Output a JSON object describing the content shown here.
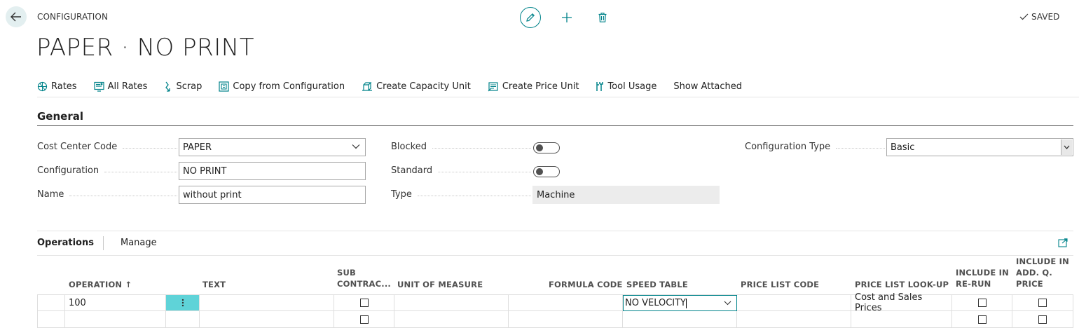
{
  "header": {
    "breadcrumb": "CONFIGURATION",
    "title": "PAPER · NO PRINT",
    "saved_label": "SAVED"
  },
  "actions": [
    {
      "label": "Rates",
      "icon": "rates-icon"
    },
    {
      "label": "All Rates",
      "icon": "all-rates-icon"
    },
    {
      "label": "Scrap",
      "icon": "scrap-icon"
    },
    {
      "label": "Copy from Configuration",
      "icon": "copy-icon"
    },
    {
      "label": "Create Capacity Unit",
      "icon": "capacity-unit-icon"
    },
    {
      "label": "Create Price Unit",
      "icon": "price-unit-icon"
    },
    {
      "label": "Tool Usage",
      "icon": "tool-usage-icon"
    },
    {
      "label": "Show Attached",
      "icon": ""
    }
  ],
  "general": {
    "title": "General",
    "cost_center_code": {
      "label": "Cost Center Code",
      "value": "PAPER"
    },
    "configuration": {
      "label": "Configuration",
      "value": "NO PRINT"
    },
    "name": {
      "label": "Name",
      "value": "without print"
    },
    "blocked": {
      "label": "Blocked",
      "value": false
    },
    "standard": {
      "label": "Standard",
      "value": false
    },
    "type": {
      "label": "Type",
      "value": "Machine"
    },
    "configuration_type": {
      "label": "Configuration Type",
      "value": "Basic"
    }
  },
  "operations": {
    "tabs": [
      "Operations",
      "Manage"
    ],
    "columns": {
      "operation": "OPERATION",
      "sort_arrow": "↑",
      "text": "TEXT",
      "subcontract_1": "SUB",
      "subcontract_2": "CONTRAC...",
      "unit_of_measure": "UNIT OF MEASURE",
      "formula_code": "FORMULA CODE",
      "speed_table": "SPEED TABLE",
      "price_list_code": "PRICE LIST CODE",
      "price_list_lookup": "PRICE LIST LOOK-UP",
      "include_rerun_1": "INCLUDE IN",
      "include_rerun_2": "RE-RUN",
      "include_addq_1": "INCLUDE IN",
      "include_addq_2": "ADD. Q.",
      "include_addq_3": "PRICE"
    },
    "rows": [
      {
        "operation": "100",
        "text": "",
        "subcontract": false,
        "unit_of_measure": "",
        "formula_code": "",
        "speed_table": "NO VELOCITY",
        "price_list_code": "",
        "price_list_lookup": "Cost and Sales Prices",
        "include_rerun": false,
        "include_addq_price": false
      },
      {
        "operation": "",
        "text": "",
        "subcontract": false,
        "unit_of_measure": "",
        "formula_code": "",
        "speed_table": "",
        "price_list_code": "",
        "price_list_lookup": "",
        "include_rerun": false,
        "include_addq_price": false
      }
    ]
  },
  "colors": {
    "accent": "#00838a",
    "row_menu_bg": "#5fd3d8"
  }
}
